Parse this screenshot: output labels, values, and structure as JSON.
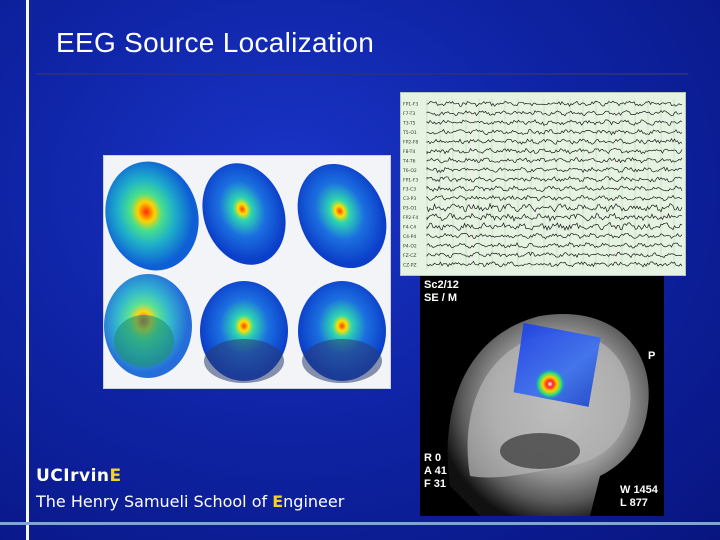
{
  "slide": {
    "title": "EEG Source Localization"
  },
  "logo": {
    "name_prefix": "UCIrvin",
    "name_highlight": "E",
    "school_prefix": "The Henry Samueli School of ",
    "school_highlight": "E",
    "school_suffix": "ngineer"
  },
  "eeg_panel": {
    "channels": [
      "FP1-F3",
      "F7-T3",
      "T3-T5",
      "T5-O1",
      "FP2-F8",
      "F8-T4",
      "T4-T6",
      "T6-O2",
      "FP1-F3",
      "F3-C3",
      "C3-P3",
      "P3-O1",
      "FP2-F4",
      "F4-C4",
      "C4-P4",
      "P4-O2",
      "FZ-CZ",
      "CZ-PZ"
    ]
  },
  "mri_panel": {
    "top_left": [
      "Sc2/12",
      "SE / M"
    ],
    "right_label": "P",
    "bottom_left": [
      "R 0",
      "A 41",
      "F 31"
    ],
    "bottom_right": [
      "W 1454",
      "L 877"
    ]
  },
  "colors": {
    "background": "#0f24a6",
    "accent_yellow": "#f3d22a",
    "text": "#ffffff"
  }
}
